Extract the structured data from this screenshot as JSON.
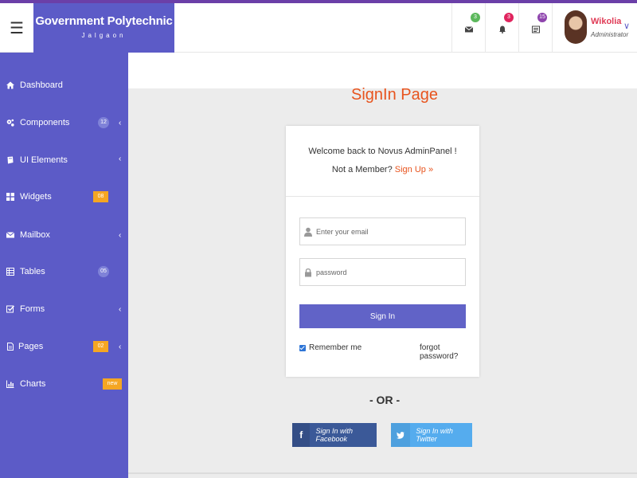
{
  "header": {
    "menu_icon": "hamburger-icon",
    "brand_title": "Government Polytechnic",
    "brand_subtitle": "Jalgaon",
    "notifications": [
      {
        "icon": "mail-icon",
        "count": "3",
        "color": "#5cb85c"
      },
      {
        "icon": "bell-icon",
        "count": "3",
        "color": "#e0245e"
      },
      {
        "icon": "tasks-icon",
        "count": "15",
        "color": "#8e44ad"
      }
    ],
    "user": {
      "name": "Wikolia",
      "role": "Administrator"
    }
  },
  "sidebar": {
    "items": [
      {
        "label": "Dashboard",
        "icon": "home-icon"
      },
      {
        "label": "Components",
        "icon": "cogs-icon",
        "count": "12"
      },
      {
        "label": "UI Elements",
        "icon": "book-icon"
      },
      {
        "label": "Widgets",
        "icon": "grid-icon",
        "tag": "08"
      },
      {
        "label": "Mailbox",
        "icon": "envelope-icon"
      },
      {
        "label": "Tables",
        "icon": "table-icon",
        "count": "05"
      },
      {
        "label": "Forms",
        "icon": "check-square-icon"
      },
      {
        "label": "Pages",
        "icon": "file-icon",
        "tag": "02"
      },
      {
        "label": "Charts",
        "icon": "chart-icon",
        "tag": "new"
      }
    ]
  },
  "main": {
    "page_title": "SignIn Page",
    "card": {
      "welcome": "Welcome back to Novus AdminPanel !",
      "not_member": "Not a Member? ",
      "signup": "Sign Up »",
      "email_placeholder": "Enter your email",
      "password_placeholder": "password",
      "signin_label": "Sign In",
      "remember_label": "Remember me",
      "forgot_label": "forgot password?"
    },
    "or_label": "- OR -",
    "facebook_label": "Sign In with Facebook",
    "twitter_label": "Sign In with Twitter"
  },
  "colors": {
    "accent": "#5c5bc7",
    "title": "#e8541e",
    "facebook": "#3b5998",
    "twitter": "#55acee"
  }
}
